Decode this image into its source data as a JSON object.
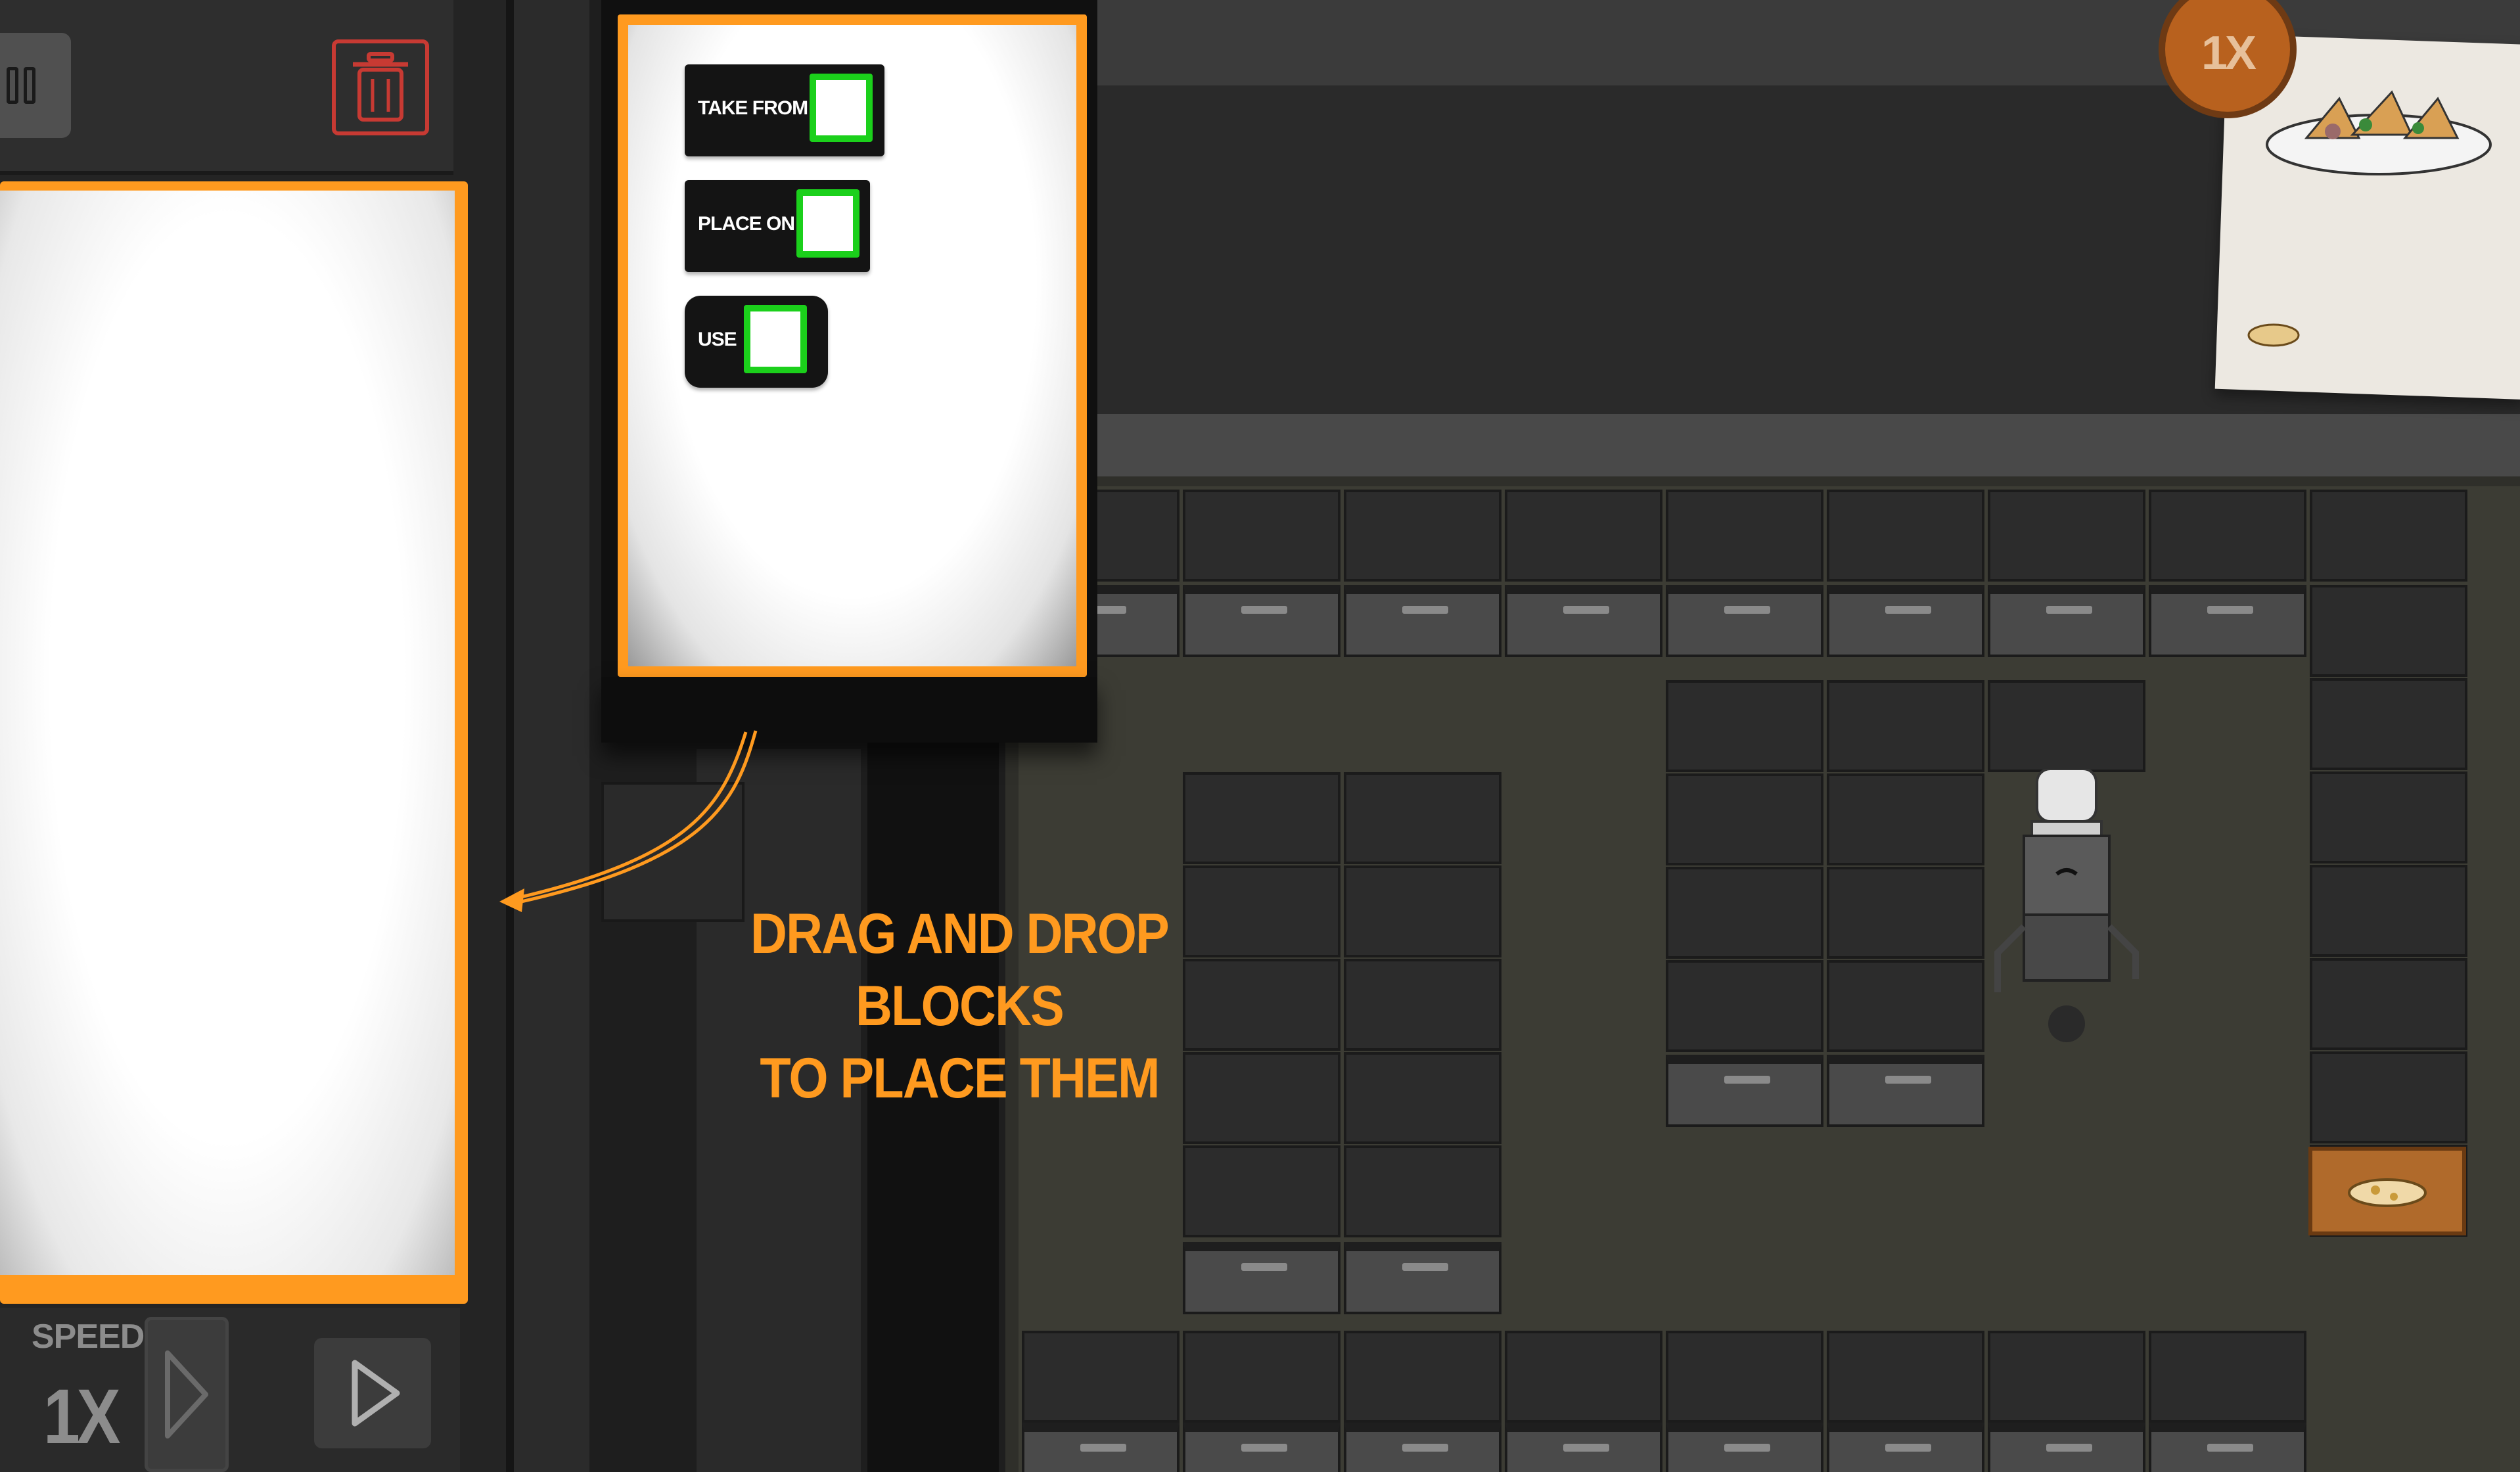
{
  "toolbar": {
    "pause_icon": "pause-icon",
    "trash_icon": "trash-icon",
    "trash_color": "#c73a33"
  },
  "palette": {
    "blocks": [
      {
        "label": "TAKE FROM"
      },
      {
        "label": "PLACE ON"
      },
      {
        "label": "USE"
      }
    ],
    "accent": "#ff9a1f",
    "slot_color": "#1bd01b"
  },
  "controls": {
    "speed_label": "SPEED:",
    "speed_value": "1X",
    "play_icon": "play-icon",
    "step_icon": "step-icon"
  },
  "order": {
    "quantity": "1X",
    "dish_icon": "nachos-icon",
    "ingredient_icon": "chips-icon"
  },
  "hint": {
    "line1": "DRAG AND DROP BLOCKS",
    "line2": "TO PLACE THEM"
  }
}
